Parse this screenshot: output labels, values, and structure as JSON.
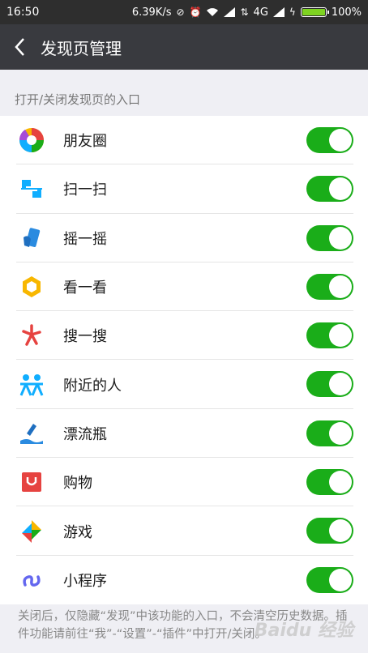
{
  "status": {
    "time": "16:50",
    "speed": "6.39K/s",
    "network": "4G",
    "battery": "100%"
  },
  "nav": {
    "title": "发现页管理"
  },
  "section": {
    "header": "打开/关闭发现页的入口"
  },
  "items": [
    {
      "label": "朋友圈",
      "icon": "moments-icon",
      "enabled": true
    },
    {
      "label": "扫一扫",
      "icon": "scan-icon",
      "enabled": true
    },
    {
      "label": "摇一摇",
      "icon": "shake-icon",
      "enabled": true
    },
    {
      "label": "看一看",
      "icon": "top-stories-icon",
      "enabled": true
    },
    {
      "label": "搜一搜",
      "icon": "search-icon",
      "enabled": true
    },
    {
      "label": "附近的人",
      "icon": "people-nearby-icon",
      "enabled": true
    },
    {
      "label": "漂流瓶",
      "icon": "drift-bottle-icon",
      "enabled": true
    },
    {
      "label": "购物",
      "icon": "shopping-icon",
      "enabled": true
    },
    {
      "label": "游戏",
      "icon": "games-icon",
      "enabled": true
    },
    {
      "label": "小程序",
      "icon": "mini-programs-icon",
      "enabled": true
    }
  ],
  "footer": {
    "text": "关闭后，仅隐藏“发现”中该功能的入口，不会清空历史数据。插件功能请前往“我”-“设置”-“插件”中打开/关闭。"
  },
  "watermark": {
    "text": "Baidu 经验"
  },
  "colors": {
    "toggle_on": "#1aad19",
    "nav_bg": "#393a3f",
    "status_bg": "#2e2e2e"
  }
}
